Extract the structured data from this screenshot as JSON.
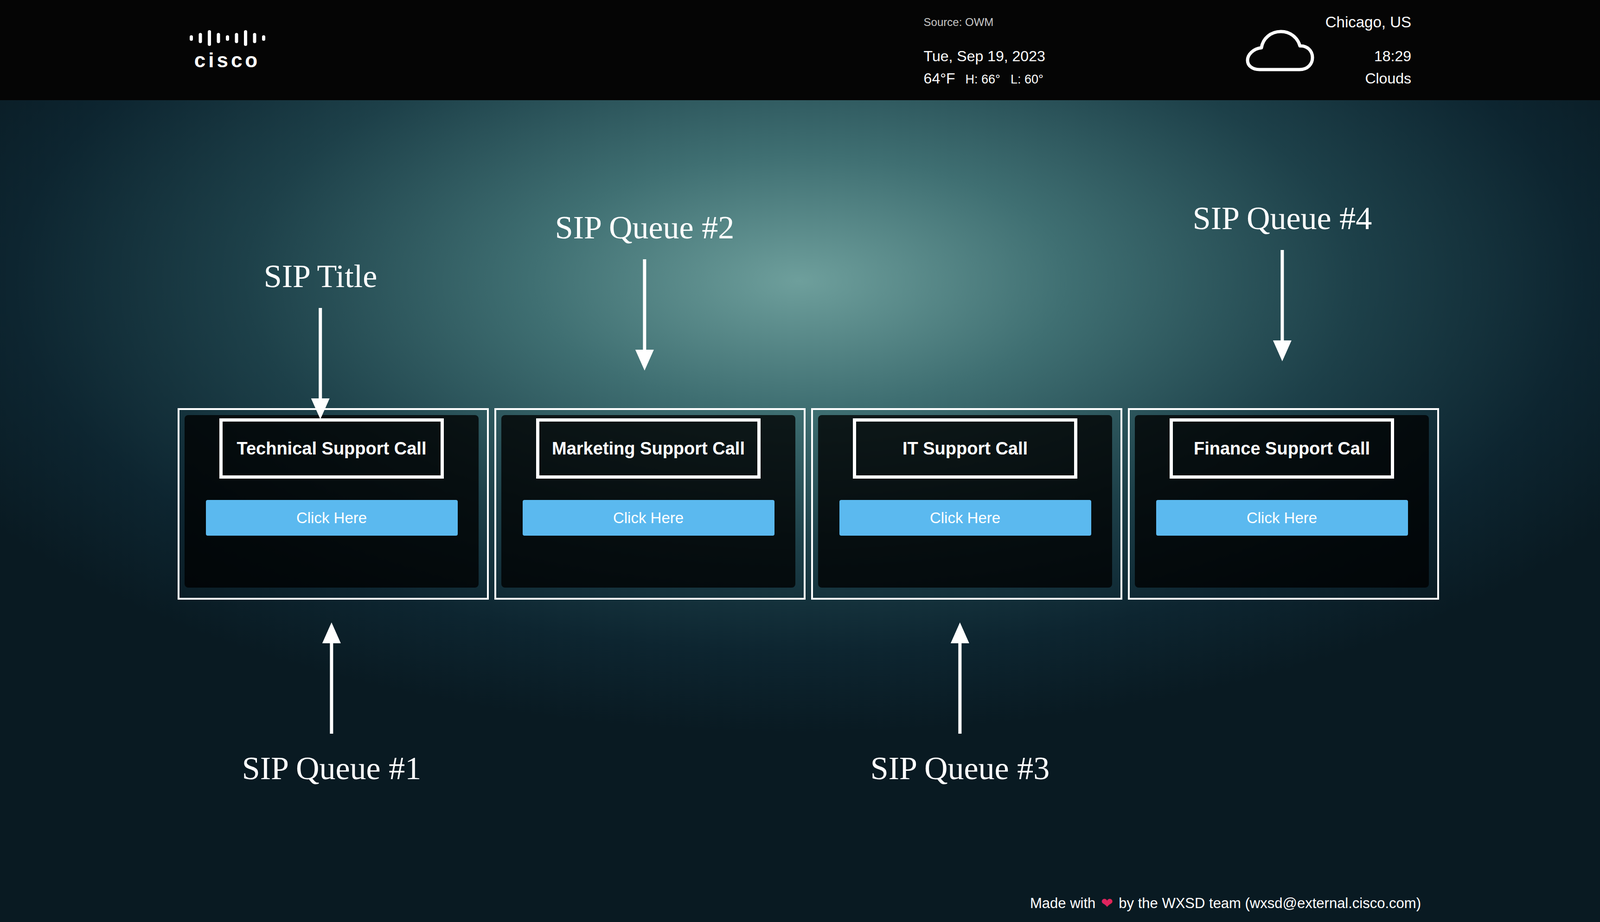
{
  "header": {
    "logo": "cisco",
    "source": "Source: OWM",
    "date": "Tue, Sep 19, 2023",
    "temperature": "64°F",
    "high": "H: 66°",
    "low": "L: 60°",
    "city": "Chicago, US",
    "time": "18:29",
    "condition": "Clouds"
  },
  "cards": [
    {
      "title": "Technical Support Call",
      "button": "Click Here"
    },
    {
      "title": "Marketing Support Call",
      "button": "Click Here"
    },
    {
      "title": "IT Support Call",
      "button": "Click Here"
    },
    {
      "title": "Finance Support Call",
      "button": "Click Here"
    }
  ],
  "annotations": [
    {
      "label": "SIP Title",
      "kind": "down"
    },
    {
      "label": "SIP Queue #2",
      "kind": "down"
    },
    {
      "label": "SIP Queue #4",
      "kind": "down"
    },
    {
      "label": "SIP Queue #1",
      "kind": "up"
    },
    {
      "label": "SIP Queue #3",
      "kind": "up"
    }
  ],
  "footer": {
    "prefix": "Made with",
    "heart": "❤",
    "suffix": "by the WXSD team (wxsd@external.cisco.com)"
  }
}
